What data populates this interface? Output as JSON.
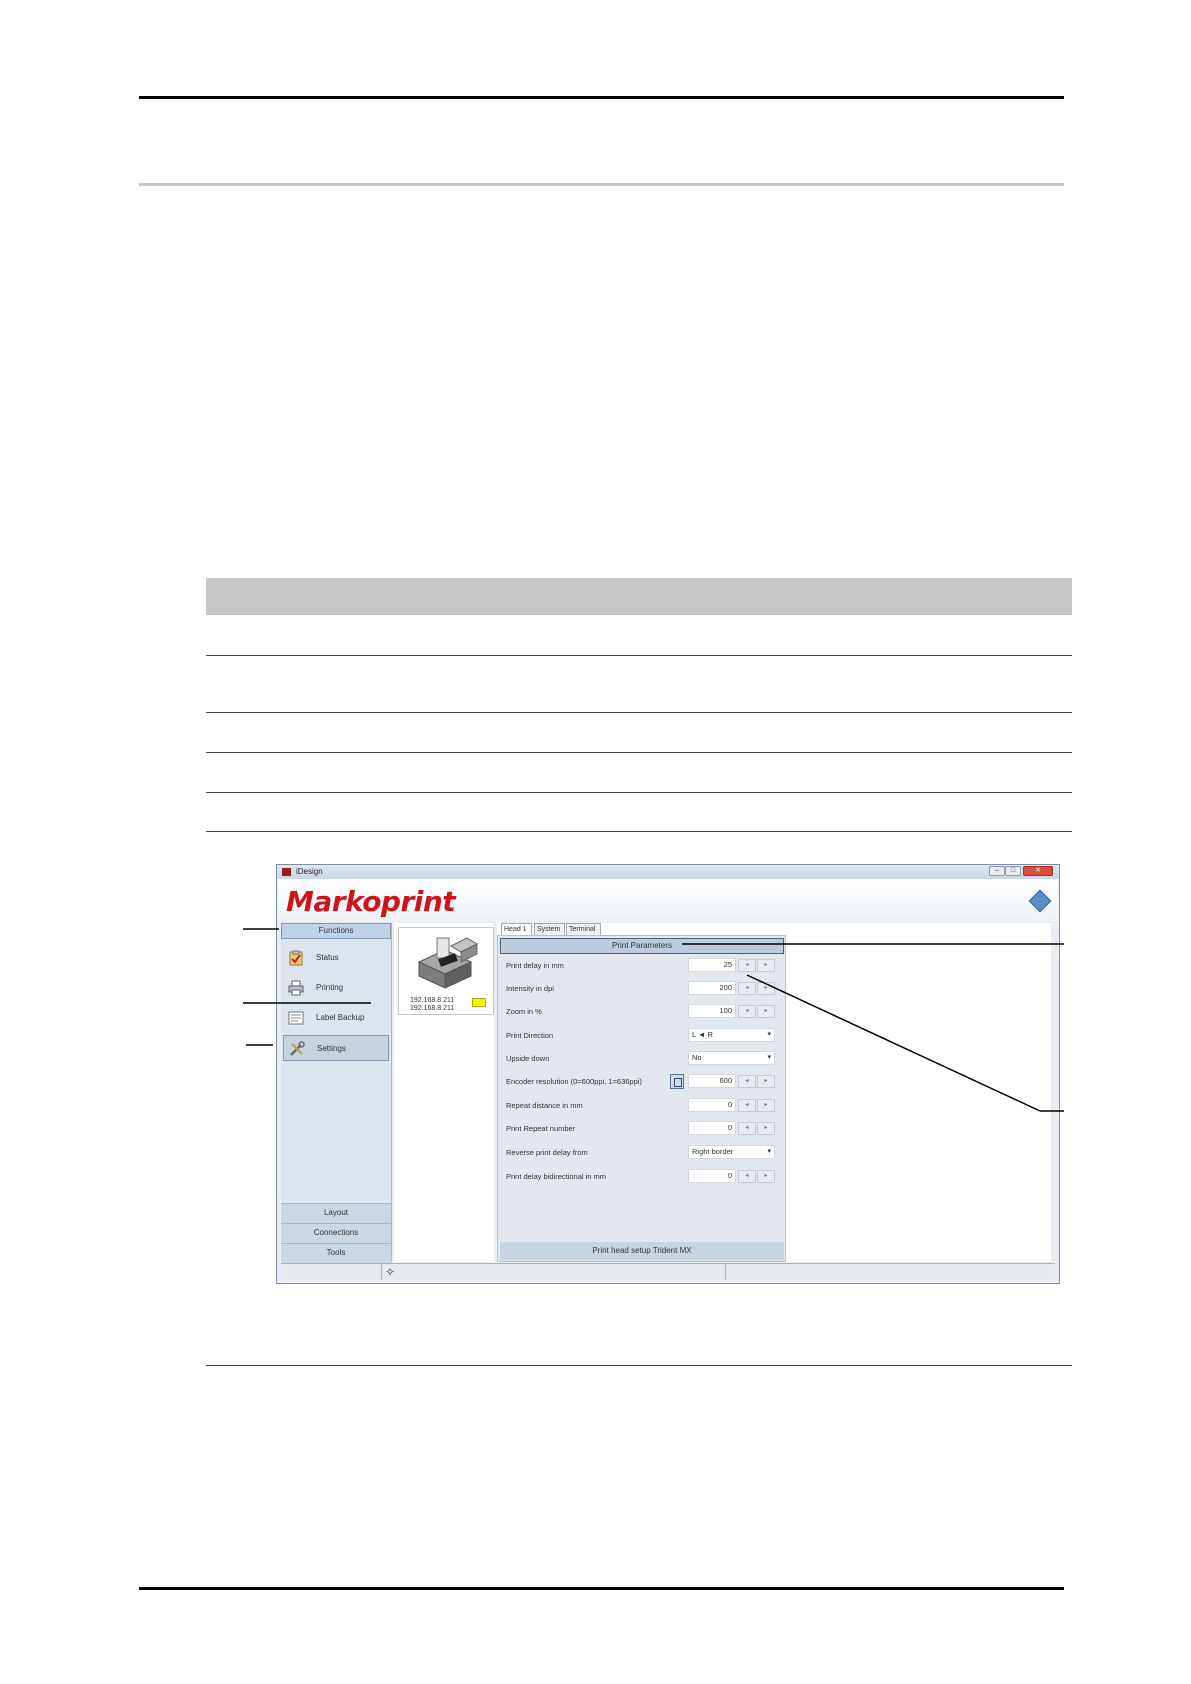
{
  "window": {
    "title": "iDesign",
    "brand": "Markoprint"
  },
  "sidebar": {
    "header": "Functions",
    "items": [
      {
        "label": "Status",
        "icon": "clipboard-check-icon"
      },
      {
        "label": "Printing",
        "icon": "printer-icon"
      },
      {
        "label": "Label Backup",
        "icon": "label-backup-icon"
      },
      {
        "label": "Settings",
        "icon": "tools-icon",
        "selected": true
      }
    ],
    "footer": [
      "Layout",
      "Connections",
      "Tools"
    ]
  },
  "device": {
    "ip_1": "192.168.8.211",
    "ip_2": "192.168.8.211",
    "status_color": "#f2ef1c"
  },
  "tabs": [
    "Head 1",
    "System",
    "Terminal"
  ],
  "params": {
    "header": "Print Parameters",
    "rows": [
      {
        "label": "Print delay in mm",
        "value": "25"
      },
      {
        "label": "Intensity in dpi",
        "value": "200"
      },
      {
        "label": "Zoom in %",
        "value": "100"
      },
      {
        "label": "Print Direction",
        "value": "L ◄ R"
      },
      {
        "label": "Upside down",
        "value": "No"
      },
      {
        "label": "Encoder resolution (0=600ppi, 1=636ppi)",
        "value": "600"
      },
      {
        "label": "Repeat distance in mm",
        "value": "0"
      },
      {
        "label": "Print Repeat number",
        "value": "0"
      },
      {
        "label": "Reverse print delay from",
        "value": "Right border"
      },
      {
        "label": "Print delay bidirectional in mm",
        "value": "0"
      }
    ],
    "footer": "Print head setup Trident MX"
  },
  "colors": {
    "brand_red": "#d0121b",
    "table_header": "#c6c6c6"
  }
}
